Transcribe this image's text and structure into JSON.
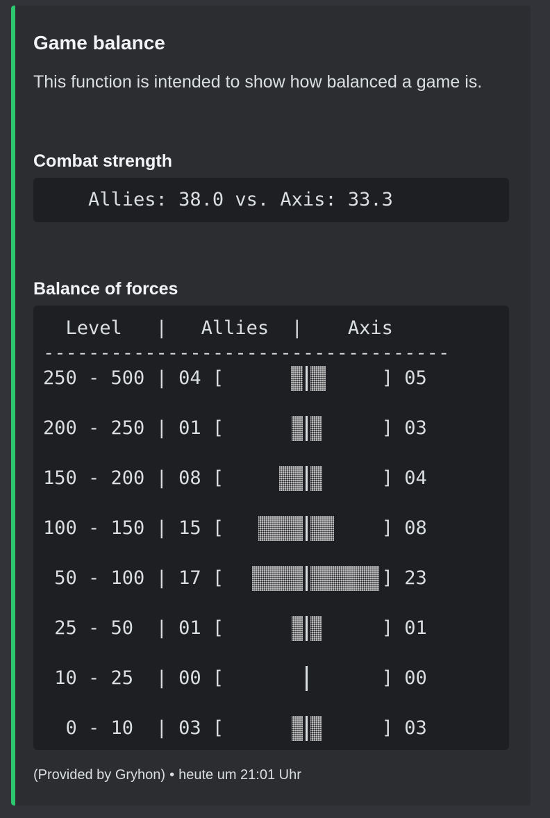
{
  "embed": {
    "accent_color": "#2dc770",
    "title": "Game balance",
    "description": "This function is intended to show how balanced a game is."
  },
  "combat": {
    "field_name": "Combat strength",
    "line": "    Allies: 38.0 vs. Axis: 33.3"
  },
  "forces": {
    "field_name": "Balance of forces",
    "header": "  Level   |   Allies  |    Axis",
    "separator": "------------------------------------",
    "rows": [
      {
        "level": "250 - 500",
        "allies": "04",
        "axis": "05",
        "allies_value": 4,
        "axis_value": 5
      },
      {
        "level": "200 - 250",
        "allies": "01",
        "axis": "03",
        "allies_value": 1,
        "axis_value": 3
      },
      {
        "level": "150 - 200",
        "allies": "08",
        "axis": "04",
        "allies_value": 8,
        "axis_value": 4
      },
      {
        "level": "100 - 150",
        "allies": "15",
        "axis": "08",
        "allies_value": 15,
        "axis_value": 8
      },
      {
        "level": " 50 - 100",
        "allies": "17",
        "axis": "23",
        "allies_value": 17,
        "axis_value": 23
      },
      {
        "level": " 25 - 50 ",
        "allies": "01",
        "axis": "01",
        "allies_value": 1,
        "axis_value": 1
      },
      {
        "level": " 10 - 25 ",
        "allies": "00",
        "axis": "00",
        "allies_value": 0,
        "axis_value": 0
      },
      {
        "level": "  0 - 10 ",
        "allies": "03",
        "axis": "03",
        "allies_value": 3,
        "axis_value": 3
      }
    ]
  },
  "footer": {
    "provider": "(Provided by Gryhon)",
    "separator": "•",
    "timestamp": "heute um 21:01 Uhr"
  }
}
